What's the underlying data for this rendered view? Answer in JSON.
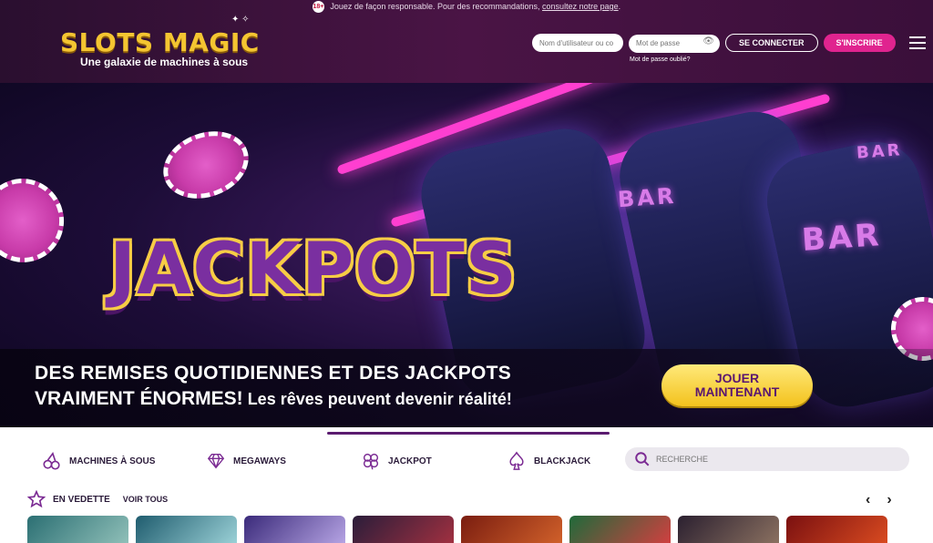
{
  "header": {
    "age_badge": "18+",
    "responsible_text": "Jouez de façon responsable. Pour des recommandations,",
    "responsible_link": "consultez notre page",
    "responsible_end": ".",
    "logo_name": "SLOTS MAGIC",
    "logo_tagline": "Une galaxie de machines à sous",
    "username_placeholder": "Nom d'utilisateur ou co",
    "password_placeholder": "Mot de passe",
    "login_button": "SE CONNECTER",
    "register_button": "S'INSCRIRE",
    "forgot_password": "Mot de passe oublié?"
  },
  "hero": {
    "headline": "JACKPOTS",
    "reel_symbol_1": "BAR",
    "reel_symbol_2": "BAR",
    "reel_symbol_3": "BAR",
    "banner_line1": "DES REMISES QUOTIDIENNES ET DES JACKPOTS",
    "banner_line2_bold": "VRAIMENT ÉNORMES!",
    "banner_line2_rest": " Les rêves peuvent devenir réalité!",
    "cta_line1": "JOUER",
    "cta_line2": "MAINTENANT"
  },
  "categories": [
    {
      "label": "MACHINES À SOUS",
      "icon": "cherries-icon"
    },
    {
      "label": "MEGAWAYS",
      "icon": "diamond-icon"
    },
    {
      "label": "JACKPOT",
      "icon": "clover-icon"
    },
    {
      "label": "BLACKJACK",
      "icon": "spade-icon"
    }
  ],
  "search": {
    "placeholder": "RECHERCHE"
  },
  "featured": {
    "title": "EN VEDETTE",
    "see_all": "VOIR TOUS",
    "prev": "‹",
    "next": "›"
  },
  "colors": {
    "accent_pink": "#e0248f",
    "brand_purple": "#5a1b6f",
    "gold": "#f4c531"
  }
}
